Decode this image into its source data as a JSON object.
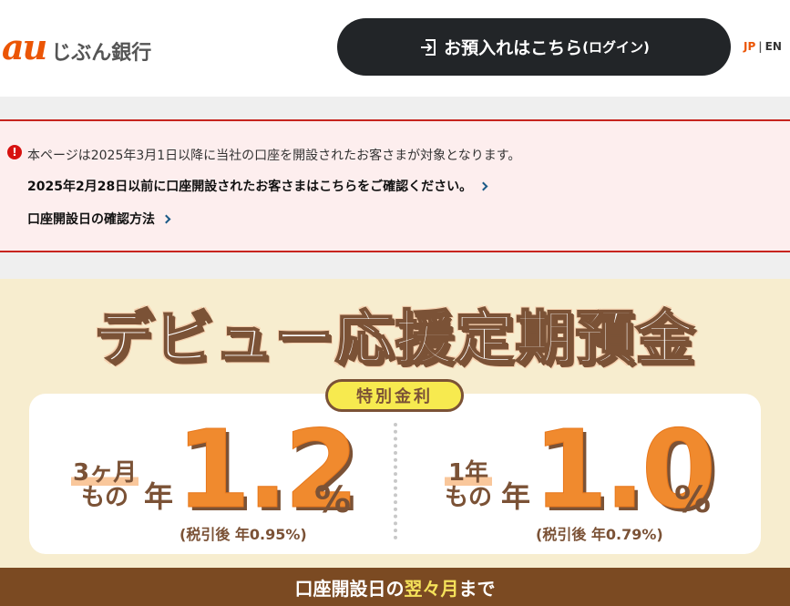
{
  "header": {
    "logo_brand": "au",
    "logo_text": "じぶん銀行",
    "login_main": "お預入れはこちら",
    "login_sub": "(ログイン)",
    "lang_jp": "JP",
    "lang_sep": "|",
    "lang_en": "EN"
  },
  "notice": {
    "icon": "!",
    "line1": "本ページは2025年3月1日以降に当社の口座を開設されたお客さまが対象となります。",
    "link1": "2025年2月28日以前に口座開設されたお客さまはこちらをご確認ください。",
    "link2": "口座開設日の確認方法"
  },
  "campaign": {
    "title": "デビュー応援定期預金",
    "badge": "特別金利",
    "left": {
      "term_line1": "3ヶ月",
      "term_line2": "もの",
      "nen": "年",
      "rate": "1.2",
      "pct": "%",
      "after_tax": "(税引後 年0.95%)"
    },
    "right": {
      "term_line1": "1年",
      "term_line2": "もの",
      "nen": "年",
      "rate": "1.0",
      "pct": "%",
      "after_tax": "(税引後 年0.79%)"
    },
    "bottom_pre": "口座開設日の",
    "bottom_highlight": "翌々月",
    "bottom_post": "まで"
  },
  "colors": {
    "accent": "#eb5505",
    "dark_button": "#222528",
    "notice_border": "#c7241e",
    "notice_bg": "#fdeeee",
    "campaign_bg": "#f7edcf",
    "rate_orange": "#f08a2e",
    "brown": "#7b5236"
  }
}
